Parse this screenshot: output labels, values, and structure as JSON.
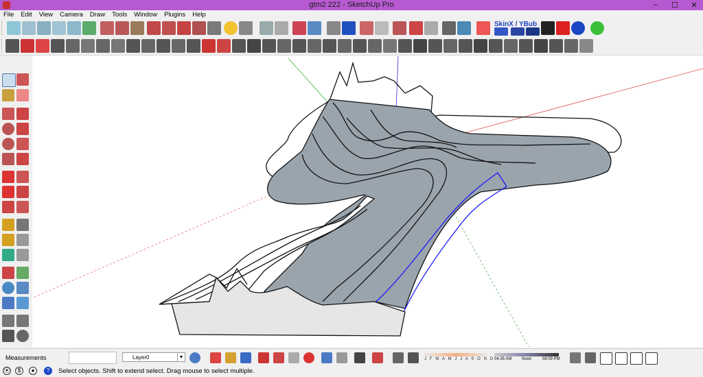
{
  "window": {
    "title": "gtm2 222 - SketchUp Pro",
    "minimize": "–",
    "maximize": "☐",
    "close": "✕"
  },
  "menu": [
    "File",
    "Edit",
    "View",
    "Camera",
    "Draw",
    "Tools",
    "Window",
    "Plugins",
    "Help"
  ],
  "toolbar": {
    "plugin_label": "SkinX / YBub"
  },
  "status": {
    "measurements_label": "Measurements",
    "layer_value": "Layer0",
    "months": "J F M A M J J A S O N D",
    "time_start": "04:35 AM",
    "time_noon": "Noon",
    "time_end": "08:09 PM",
    "hint": "Select objects. Shift to extend select. Drag mouse to select multiple."
  },
  "colors": {
    "title_bar": "#b75ad1",
    "face_gray": "#9aa4ad",
    "axis_red": "#e05050",
    "axis_green": "#3fae3f",
    "axis_blue": "#3030d8",
    "selection_blue": "#1010ff"
  }
}
